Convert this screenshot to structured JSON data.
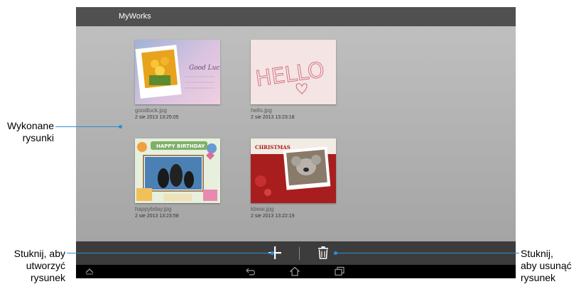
{
  "app": {
    "title": "MyWorks"
  },
  "files": [
    {
      "name": "goodluck.jpg",
      "date": "2 sie 2013 13:25:05",
      "thumb_text": "Good Luck"
    },
    {
      "name": "hello.jpg",
      "date": "2 sie 2013 13:23:18",
      "thumb_text": "HELLO"
    },
    {
      "name": "happybday.jpg",
      "date": "2 sie 2013 13:23:58",
      "thumb_text": "HAPPY BIRTHDAY"
    },
    {
      "name": "kbear.jpg",
      "date": "2 sie 2013 13:22:19",
      "thumb_text": "CHRISTMAS"
    }
  ],
  "toolbar": {
    "add_icon": "plus-icon",
    "delete_icon": "trash-icon"
  },
  "navbar": {
    "icons": [
      "chevron-up-icon",
      "back-icon",
      "home-icon",
      "recent-apps-icon"
    ]
  },
  "callouts": {
    "drawings": [
      "Wykonane",
      "rysunki"
    ],
    "create": [
      "Stuknij, aby",
      "utworzyć",
      "rysunek"
    ],
    "delete": [
      "Stuknij,",
      "aby usunąć",
      "rysunek"
    ]
  },
  "colors": {
    "leader": "#2a8fd6",
    "titlebar": "#505050",
    "toolbar": "#3c3c3c",
    "navbar": "#000000"
  }
}
